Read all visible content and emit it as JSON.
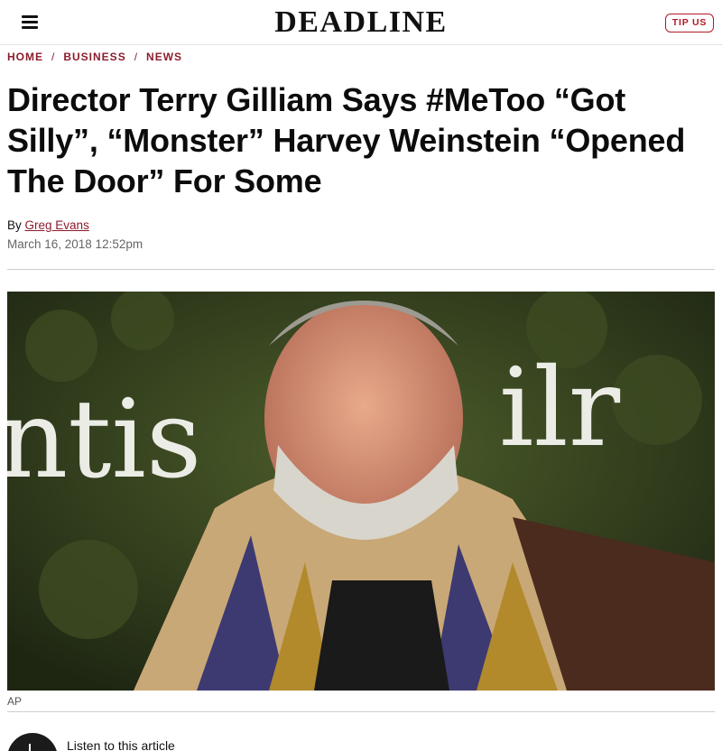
{
  "header": {
    "logo": "DEADLINE",
    "tip_label": "TIP US"
  },
  "breadcrumb": [
    "HOME",
    "BUSINESS",
    "NEWS"
  ],
  "article": {
    "title": "Director Terry Gilliam Says #MeToo “Got Silly”, “Monster” Harvey Weinstein “Opened The Door” For Some",
    "by_prefix": "By",
    "author": "Greg Evans",
    "date": "March 16, 2018 12:52pm",
    "photo_credit": "AP",
    "listen_label": "Listen to this article"
  },
  "colors": {
    "accent": "#8c1d2c",
    "tip_border": "#b01826"
  },
  "icons": {
    "menu": "hamburger-menu-icon",
    "listen": "audio-play-icon"
  }
}
